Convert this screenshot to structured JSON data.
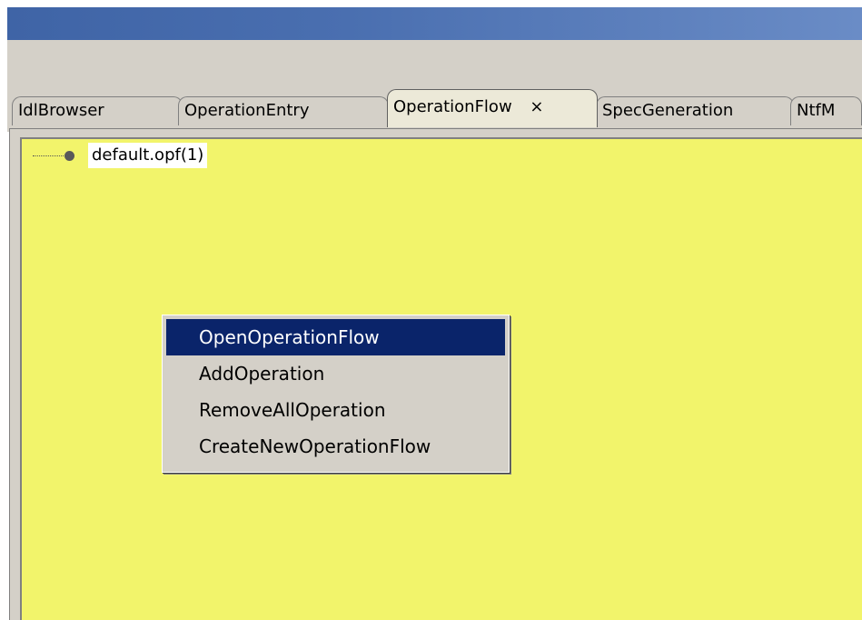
{
  "tabs": [
    {
      "label": "IdlBrowser"
    },
    {
      "label": "OperationEntry"
    },
    {
      "label": "OperationFlow",
      "close": "×"
    },
    {
      "label": "SpecGeneration"
    },
    {
      "label": "NtfM"
    }
  ],
  "active_tab": "OperationFlow",
  "tree": {
    "root_label": "default.opf(1)"
  },
  "context_menu": {
    "items": [
      {
        "label": "OpenOperationFlow"
      },
      {
        "label": "AddOperation"
      },
      {
        "label": "RemoveAllOperation"
      },
      {
        "label": "CreateNewOperationFlow"
      }
    ],
    "selected_index": 0
  },
  "colors": {
    "canvas_background": "#f2f46b",
    "selection_background": "#0a246a",
    "chrome": "#d4d0c8",
    "titlebar": "#4a6fb0"
  }
}
